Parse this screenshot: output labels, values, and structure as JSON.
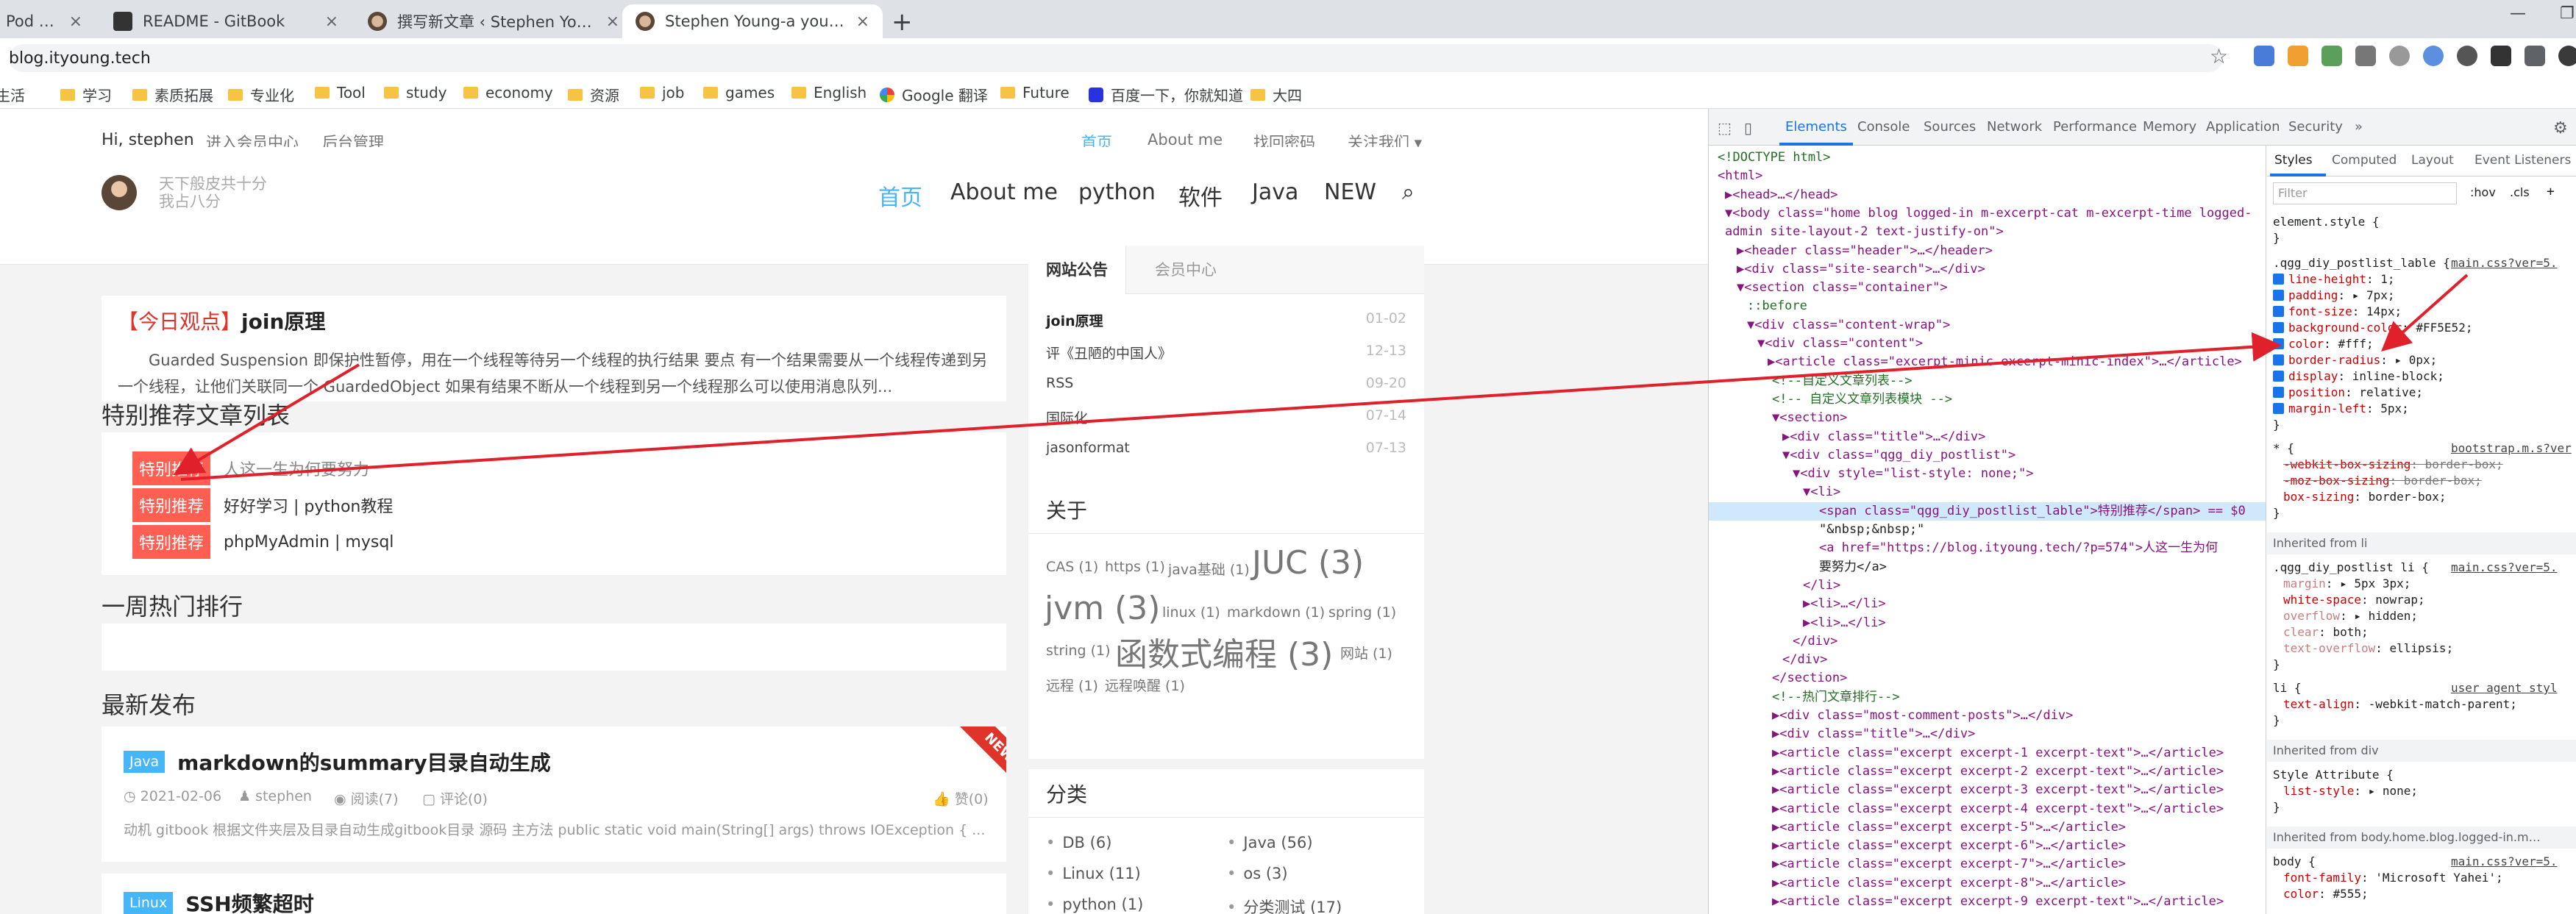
{
  "browser": {
    "tabs": [
      {
        "title": "Pod - C",
        "active": false
      },
      {
        "title": "README - GitBook",
        "active": false
      },
      {
        "title": "撰写新文章 ‹ Stephen Young —",
        "active": false
      },
      {
        "title": "Stephen Young-a young man",
        "active": true
      }
    ],
    "close_glyph": "×",
    "new_tab_glyph": "+",
    "address": "blog.ityoung.tech",
    "bookmarks": [
      "生活",
      "学习",
      "素质拓展",
      "专业化",
      "Tool",
      "study",
      "economy",
      "资源",
      "job",
      "games",
      "English",
      "Google 翻译",
      "Future",
      "百度一下，你就知道",
      "大四"
    ],
    "window_glyphs": {
      "minimize": "—",
      "restore": "❐"
    }
  },
  "site": {
    "greeting": "Hi, stephen",
    "top_links": [
      "进入会员中心",
      "后台管理"
    ],
    "top_right_links": [
      "首页",
      "About me",
      "找回密码",
      "关注我们 ▾"
    ],
    "slogan": [
      "天下般皮共十分",
      "我占八分"
    ],
    "main_nav": [
      "首页",
      "About me",
      "python",
      "软件",
      "Java",
      "NEW"
    ],
    "featured": {
      "tag": "【今日观点】",
      "title": "join原理",
      "excerpt": "Guarded Suspension 即保护性暂停，用在一个线程等待另一个线程的执行结果 要点 有一个结果需要从一个线程传递到另一个线程，让他们关联同一个 GuardedObject 如果有结果不断从一个线程到另一个线程那么可以使用消息队列..."
    },
    "recommend": {
      "title": "特别推荐文章列表",
      "badge": "特别推荐",
      "items": [
        "人这一生为何要努力",
        "好好学习 | python教程",
        "phpMyAdmin | mysql"
      ]
    },
    "weekly_hot_title": "一周热门排行",
    "latest_title": "最新发布",
    "posts": [
      {
        "category": "Java",
        "title": "markdown的summary目录自动生成",
        "date": "2021-02-06",
        "author": "stephen",
        "views": "阅读(7)",
        "comments": "评论(0)",
        "likes": "赞(0)",
        "excerpt": "动机 gitbook 根据文件夹层及目录自动生成gitbook目录 源码 主方法  public static void main(String[] args) throws IOException {     ...",
        "ribbon": "NEW"
      },
      {
        "category": "Linux",
        "title": "SSH频繁超时"
      }
    ],
    "sidebar": {
      "tabs": [
        "网站公告",
        "会员中心"
      ],
      "notices": [
        {
          "text": "join原理",
          "date": "01-02"
        },
        {
          "text": "评《丑陋的中国人》",
          "date": "12-13"
        },
        {
          "text": "RSS",
          "date": "09-20"
        },
        {
          "text": "国际化",
          "date": "07-14"
        },
        {
          "text": "jasonformat",
          "date": "07-13"
        }
      ],
      "about_title": "关于",
      "tag_cloud": [
        {
          "text": "CAS (1)",
          "size": 19
        },
        {
          "text": "https (1)",
          "size": 19
        },
        {
          "text": "java基础 (1)",
          "size": 19
        },
        {
          "text": "JUC (3)",
          "size": 44
        },
        {
          "text": "jvm (3)",
          "size": 44
        },
        {
          "text": "linux (1)",
          "size": 19
        },
        {
          "text": "markdown (1)",
          "size": 19
        },
        {
          "text": "spring (1)",
          "size": 19
        },
        {
          "text": "string (1)",
          "size": 19
        },
        {
          "text": "函数式编程 (3)",
          "size": 44
        },
        {
          "text": "网站 (1)",
          "size": 19
        },
        {
          "text": "远程 (1)",
          "size": 19
        },
        {
          "text": "远程唤醒 (1)",
          "size": 19
        }
      ],
      "category_title": "分类",
      "categories": [
        "DB (6)",
        "Java (56)",
        "Linux (11)",
        "os (3)",
        "python (1)",
        "分类测试 (17)"
      ]
    }
  },
  "devtools": {
    "tabs": [
      "Elements",
      "Console",
      "Sources",
      "Network",
      "Performance",
      "Memory",
      "Application",
      "Security",
      "»"
    ],
    "dom_lines": [
      "<!DOCTYPE html>",
      "<html>",
      "▶<head>…</head>",
      "▼<body class=\"home blog logged-in m-excerpt-cat m-excerpt-time logged-",
      "admin site-layout-2 text-justify-on\">",
      "▶<header class=\"header\">…</header>",
      "▶<div class=\"site-search\">…</div>",
      "▼<section class=\"container\">",
      "::before",
      "▼<div class=\"content-wrap\">",
      "▼<div class=\"content\">",
      "▶<article class=\"excerpt-minic excerpt-minic-index\">…</article>",
      "<!--自定义文章列表-->",
      "<!-- 自定义文章列表模块 -->",
      "▼<section>",
      "▶<div class=\"title\">…</div>",
      "▼<div class=\"qgg_diy_postlist\">",
      "▼<div style=\"list-style: none;\">",
      "▼<li>",
      "<span class=\"qgg_diy_postlist_lable\">特别推荐</span> == $0",
      "\"&nbsp;&nbsp;\"",
      "<a href=\"https://blog.ityoung.tech/?p=574\">人这一生为何",
      "要努力</a>",
      "</li>",
      "▶<li>…</li>",
      "▶<li>…</li>",
      "</div>",
      "</div>",
      "</section>",
      "<!--热门文章排行-->",
      "▶<div class=\"most-comment-posts\">…</div>",
      "▶<div class=\"title\">…</div>",
      "▶<article class=\"excerpt excerpt-1 excerpt-text\">…</article>",
      "▶<article class=\"excerpt excerpt-2 excerpt-text\">…</article>",
      "▶<article class=\"excerpt excerpt-3 excerpt-text\">…</article>",
      "▶<article class=\"excerpt excerpt-4 excerpt-text\">…</article>",
      "▶<article class=\"excerpt excerpt-5\">…</article>",
      "▶<article class=\"excerpt excerpt-6\">…</article>",
      "▶<article class=\"excerpt excerpt-7\">…</article>",
      "▶<article class=\"excerpt excerpt-8\">…</article>",
      "▶<article class=\"excerpt excerpt-9 excerpt-text\">…</article>"
    ],
    "styles_tabs": [
      "Styles",
      "Computed",
      "Layout",
      "Event Listeners"
    ],
    "filter_placeholder": "Filter",
    "filter_buttons": [
      ":hov",
      ".cls",
      "+"
    ],
    "rules": {
      "element_style": "element.style {",
      "selector": ".qgg_diy_postlist_lable {",
      "source": "main.css?ver=5.",
      "props": [
        "line-height: 1;",
        "padding: ▸ 7px;",
        "font-size: 14px;",
        "background-color: #FF5E52;",
        "color: #fff;",
        "border-radius: ▸ 0px;",
        "display: inline-block;",
        "position: relative;",
        "margin-left: 5px;"
      ],
      "universal": "* {",
      "universal_src": "bootstrap.m.s?ver",
      "universal_props": [
        "-webkit-box-sizing: border-box;",
        "-moz-box-sizing: border-box;",
        "box-sizing: border-box;"
      ],
      "inherited_li": "Inherited from li",
      "li_selector": ".qgg_diy_postlist li {",
      "li_props": [
        "margin: ▸ 5px 3px;",
        "white-space: nowrap;",
        "overflow: ▸ hidden;",
        "clear: both;",
        "text-overflow: ellipsis;"
      ],
      "li_ua": "li {",
      "ua_label": "user agent styl",
      "li_ua_prop": "text-align: -webkit-match-parent;",
      "inherited_div": "Inherited from div",
      "style_attr": "Style Attribute {",
      "style_attr_prop": "list-style: ▸ none;",
      "inherited_body": "Inherited from body.home.blog.logged-in.m…",
      "body_selector": "body {",
      "body_props": [
        "font-family: 'Microsoft Yahei';",
        "color: #555;"
      ]
    }
  },
  "colors": {
    "accent": "#45b6f7",
    "red": "#e0332a",
    "badge": "#FF5E52",
    "devtools_blue": "#1a73e8"
  }
}
